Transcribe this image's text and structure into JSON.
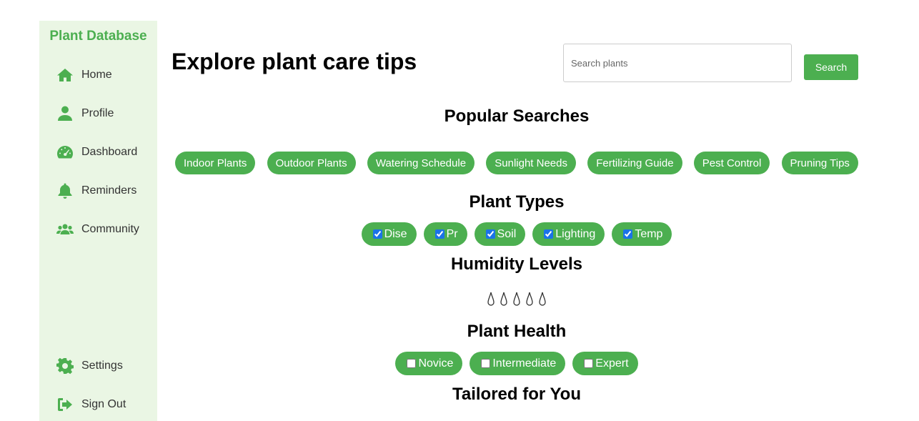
{
  "sidebar": {
    "brand": "Plant Database",
    "items": [
      {
        "label": "Home",
        "icon": "home-icon"
      },
      {
        "label": "Profile",
        "icon": "user-icon"
      },
      {
        "label": "Dashboard",
        "icon": "gauge-icon"
      },
      {
        "label": "Reminders",
        "icon": "bell-icon"
      },
      {
        "label": "Community",
        "icon": "users-icon"
      }
    ],
    "bottom_items": [
      {
        "label": "Settings",
        "icon": "gear-icon"
      },
      {
        "label": "Sign Out",
        "icon": "sign-out-icon"
      }
    ]
  },
  "header": {
    "title": "Explore plant care tips",
    "search_placeholder": "Search plants",
    "search_button": "Search"
  },
  "popular": {
    "title": "Popular Searches",
    "tags": [
      "Indoor Plants",
      "Outdoor Plants",
      "Watering Schedule",
      "Sunlight Needs",
      "Fertilizing Guide",
      "Pest Control",
      "Pruning Tips"
    ]
  },
  "plant_types": {
    "title": "Plant Types",
    "options": [
      {
        "label": "Dise",
        "checked": true
      },
      {
        "label": "Pr",
        "checked": true
      },
      {
        "label": "Soil",
        "checked": true
      },
      {
        "label": "Lighting",
        "checked": true
      },
      {
        "label": "Temp",
        "checked": true
      }
    ]
  },
  "humidity": {
    "title": "Humidity Levels",
    "levels_total": 5,
    "icon": "water-drop-icon"
  },
  "plant_health": {
    "title": "Plant Health",
    "options": [
      {
        "label": "Novice",
        "checked": false
      },
      {
        "label": "Intermediate",
        "checked": false
      },
      {
        "label": "Expert",
        "checked": false
      }
    ]
  },
  "tailored": {
    "title": "Tailored for You"
  },
  "colors": {
    "accent": "#4caf50",
    "sidebar_bg": "#eaf6e4"
  }
}
